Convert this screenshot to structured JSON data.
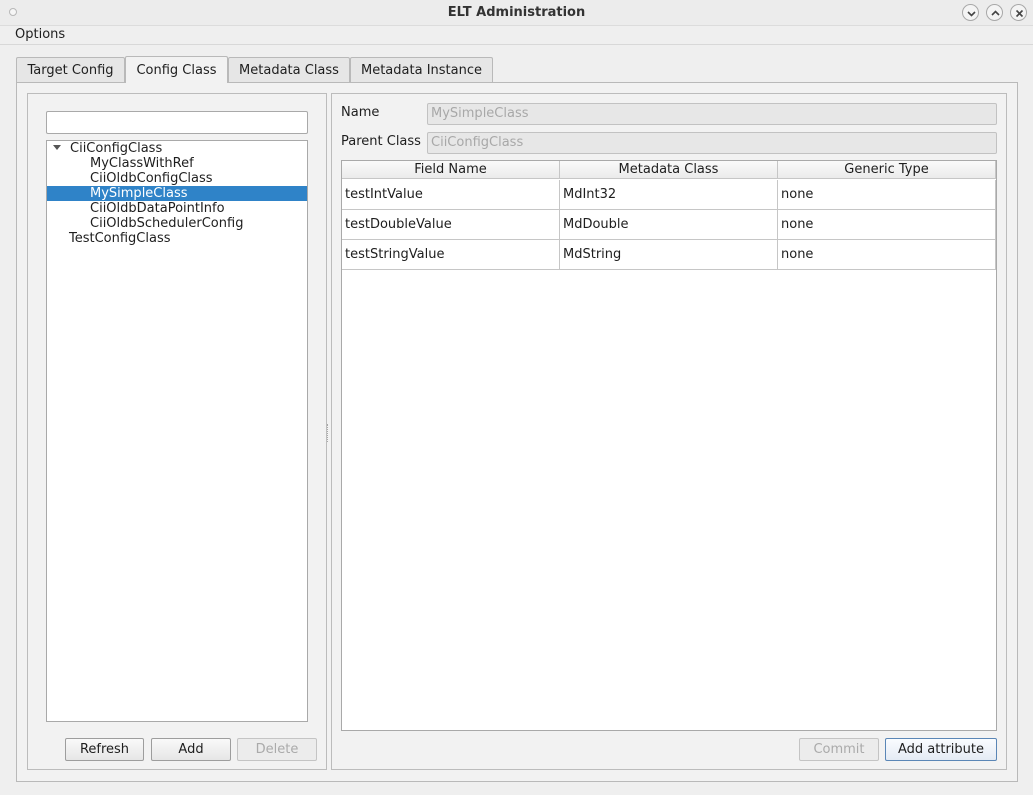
{
  "window": {
    "title": "ELT Administration"
  },
  "menu": {
    "options": "Options"
  },
  "tabs": [
    "Target Config",
    "Config Class",
    "Metadata Class",
    "Metadata Instance"
  ],
  "active_tab": "Config Class",
  "tree": {
    "search_value": "",
    "items": [
      {
        "label": "CiiConfigClass",
        "expanded": true
      },
      {
        "label": "MyClassWithRef"
      },
      {
        "label": "CiiOldbConfigClass"
      },
      {
        "label": "MySimpleClass",
        "selected": true
      },
      {
        "label": "CiiOldbDataPointInfo"
      },
      {
        "label": "CiiOldbSchedulerConfig"
      },
      {
        "label": "TestConfigClass"
      }
    ]
  },
  "left_buttons": {
    "refresh": "Refresh",
    "add": "Add",
    "delete": "Delete"
  },
  "form": {
    "name_label": "Name",
    "name_value": "MySimpleClass",
    "parent_label": "Parent Class",
    "parent_value": "CiiConfigClass"
  },
  "table": {
    "columns": [
      "Field Name",
      "Metadata Class",
      "Generic Type"
    ],
    "rows": [
      [
        "testIntValue",
        "MdInt32",
        "none"
      ],
      [
        "testDoubleValue",
        "MdDouble",
        "none"
      ],
      [
        "testStringValue",
        "MdString",
        "none"
      ]
    ]
  },
  "right_buttons": {
    "commit": "Commit",
    "add_attribute": "Add attribute"
  },
  "colors": {
    "selection": "#2f83c8",
    "default_button_border": "#5a86b6"
  },
  "icons": {
    "minimize": "chevron-down-icon",
    "maximize": "chevron-up-icon",
    "close": "close-icon"
  }
}
